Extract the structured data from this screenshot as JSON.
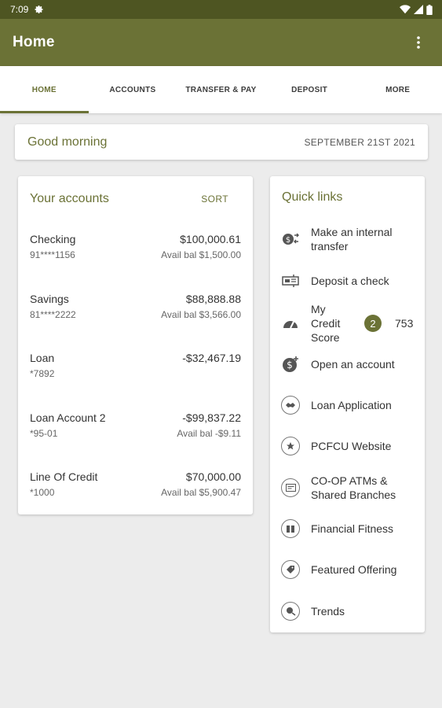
{
  "status_bar": {
    "time": "7:09"
  },
  "app_bar": {
    "title": "Home"
  },
  "tabs": [
    {
      "label": "HOME"
    },
    {
      "label": "ACCOUNTS"
    },
    {
      "label": "TRANSFER & PAY"
    },
    {
      "label": "DEPOSIT"
    },
    {
      "label": "MORE"
    }
  ],
  "active_tab": "HOME",
  "greeting": {
    "text": "Good morning",
    "date": "SEPTEMBER 21ST 2021"
  },
  "accounts": {
    "title": "Your accounts",
    "sort_label": "SORT",
    "items": [
      {
        "name": "Checking",
        "number": "91****1156",
        "balance": "$100,000.61",
        "available": "Avail bal $1,500.00"
      },
      {
        "name": "Savings",
        "number": "81****2222",
        "balance": "$88,888.88",
        "available": "Avail bal $3,566.00"
      },
      {
        "name": "Loan",
        "number": "*7892",
        "balance": "-$32,467.19",
        "available": ""
      },
      {
        "name": "Loan Account 2",
        "number": "*95-01",
        "balance": "-$99,837.22",
        "available": "Avail bal -$9.11"
      },
      {
        "name": "Line Of Credit",
        "number": "*1000",
        "balance": "$70,000.00",
        "available": "Avail bal $5,900.47"
      }
    ]
  },
  "quick_links": {
    "title": "Quick links",
    "items": [
      {
        "label": "Make an internal transfer",
        "icon": "transfer-icon"
      },
      {
        "label": "Deposit a check",
        "icon": "check-deposit-icon"
      },
      {
        "label": "My Credit Score",
        "icon": "gauge-icon",
        "badge": "2",
        "score": "753"
      },
      {
        "label": "Open an account",
        "icon": "add-money-icon"
      },
      {
        "label": "Loan Application",
        "icon": "handshake-icon"
      },
      {
        "label": "PCFCU Website",
        "icon": "star-icon"
      },
      {
        "label": "CO-OP ATMs & Shared Branches",
        "icon": "atm-icon"
      },
      {
        "label": "Financial Fitness",
        "icon": "book-icon"
      },
      {
        "label": "Featured Offering",
        "icon": "tag-icon"
      },
      {
        "label": "Trends",
        "icon": "trends-icon"
      }
    ]
  },
  "colors": {
    "status_bar": "#4e5522",
    "primary": "#6b7236",
    "background": "#ececec"
  }
}
